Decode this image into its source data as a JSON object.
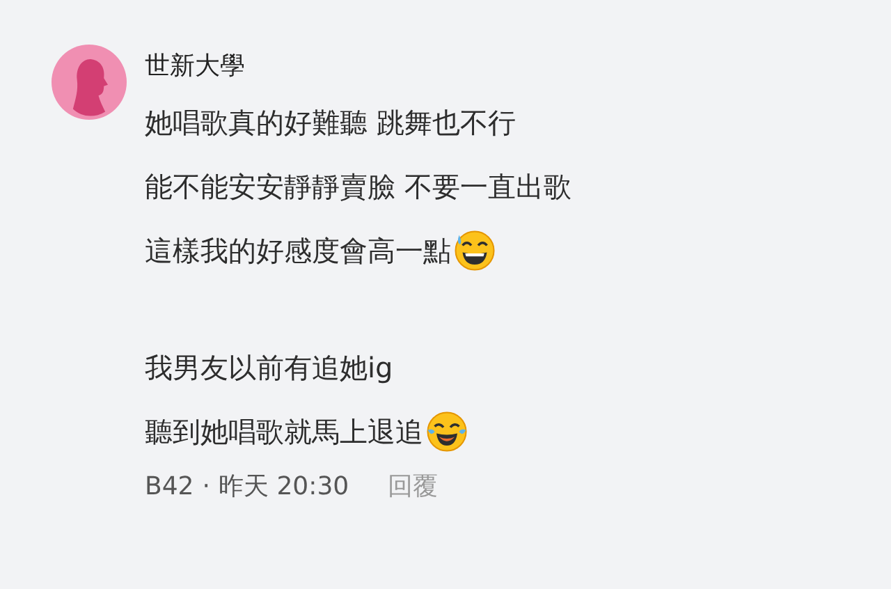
{
  "comment": {
    "author": "世新大學",
    "paragraphs": [
      [
        {
          "kind": "plain",
          "text": "她唱歌真的好難聽 跳舞也不行"
        },
        {
          "kind": "plain",
          "text": "能不能安安靜靜賣臉 不要一直出歌"
        },
        {
          "kind": "sweat",
          "text": "這樣我的好感度會高一點"
        }
      ],
      [
        {
          "kind": "plain",
          "text": "我男友以前有追她ig"
        },
        {
          "kind": "joy",
          "text": "聽到她唱歌就馬上退追"
        }
      ]
    ],
    "floor": "B42",
    "separator": "·",
    "time": "昨天 20:30",
    "reply": "回覆"
  }
}
